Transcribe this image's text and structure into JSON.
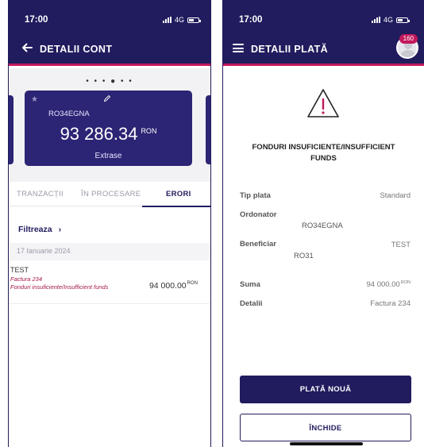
{
  "left_screen": {
    "status": {
      "time": "17:00",
      "network": "4G"
    },
    "header": {
      "title": "DETALII CONT"
    },
    "account_card": {
      "iban": "RO34EGNA",
      "balance": "93 286.34",
      "currency": "RON",
      "link_label": "Extrase"
    },
    "tabs": [
      {
        "label": "TRANZACȚII"
      },
      {
        "label": "ÎN PROCESARE"
      },
      {
        "label": "ERORI"
      }
    ],
    "active_tab": "ERORI",
    "filter_label": "Filtreaza",
    "date_group": "17 Ianuarie 2024",
    "transaction": {
      "name": "TEST",
      "reference": "Factura 234",
      "error": "Fonduri insuficiente/Insufficient funds",
      "amount": "94 000.00",
      "currency": "RON"
    }
  },
  "right_screen": {
    "status": {
      "time": "17:00",
      "network": "4G"
    },
    "header": {
      "title": "DETALII PLATĂ"
    },
    "badge_count": "160",
    "error_title": "FONDURI INSUFICIENTE/INSUFFICIENT FUNDS",
    "details": {
      "payment_type_label": "Tip plata",
      "payment_type_value": "Standard",
      "payer_label": "Ordonator",
      "payer_value": "RO34EGNA",
      "beneficiary_label": "Beneficiar",
      "beneficiary_name": "TEST",
      "beneficiary_iban": "RO31",
      "amount_label": "Suma",
      "amount_value": "94 000.00",
      "amount_currency": "RON",
      "details_label": "Detalii",
      "details_value": "Factura 234"
    },
    "buttons": {
      "new_payment": "PLATĂ NOUĂ",
      "close": "ÎNCHIDE"
    }
  },
  "colors": {
    "header": "#211c5e",
    "accent": "#c2185b",
    "card": "#2c2474",
    "error_text": "#a4154c"
  }
}
